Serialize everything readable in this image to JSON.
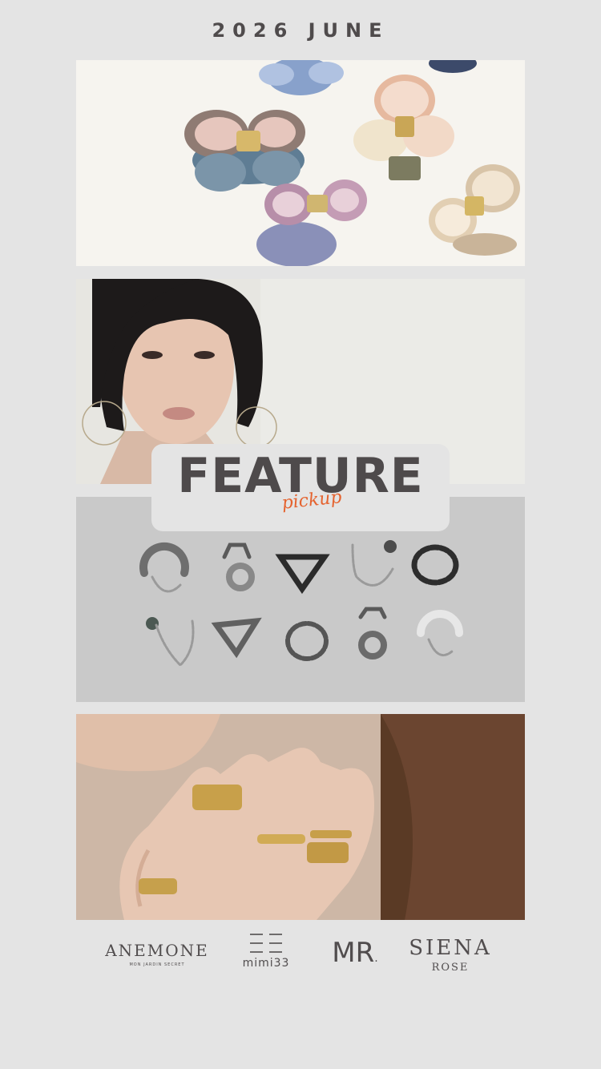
{
  "header": {
    "date": "2026 JUNE"
  },
  "panels": [
    {
      "subject": "butterfly-hair-claw-clips"
    },
    {
      "subject": "model-with-hoop-earrings"
    },
    {
      "subject": "silver-ear-cuffs-and-earrings"
    },
    {
      "subject": "gold-rings-on-hand"
    }
  ],
  "feature": {
    "title": "FEATURE",
    "subtitle": "pickup",
    "subtitle_color": "#e5632f"
  },
  "brands": {
    "anemone": {
      "name": "ANEMONE",
      "tagline": "MON JARDIN SECRET"
    },
    "mimi33": {
      "name": "mimi33"
    },
    "mr": {
      "name": "MR",
      "dot": "."
    },
    "siena": {
      "name": "SIENA",
      "sub": "ROSE"
    }
  },
  "colors": {
    "background": "#e4e4e4",
    "text": "#4f4b4c",
    "accent": "#e5632f"
  }
}
